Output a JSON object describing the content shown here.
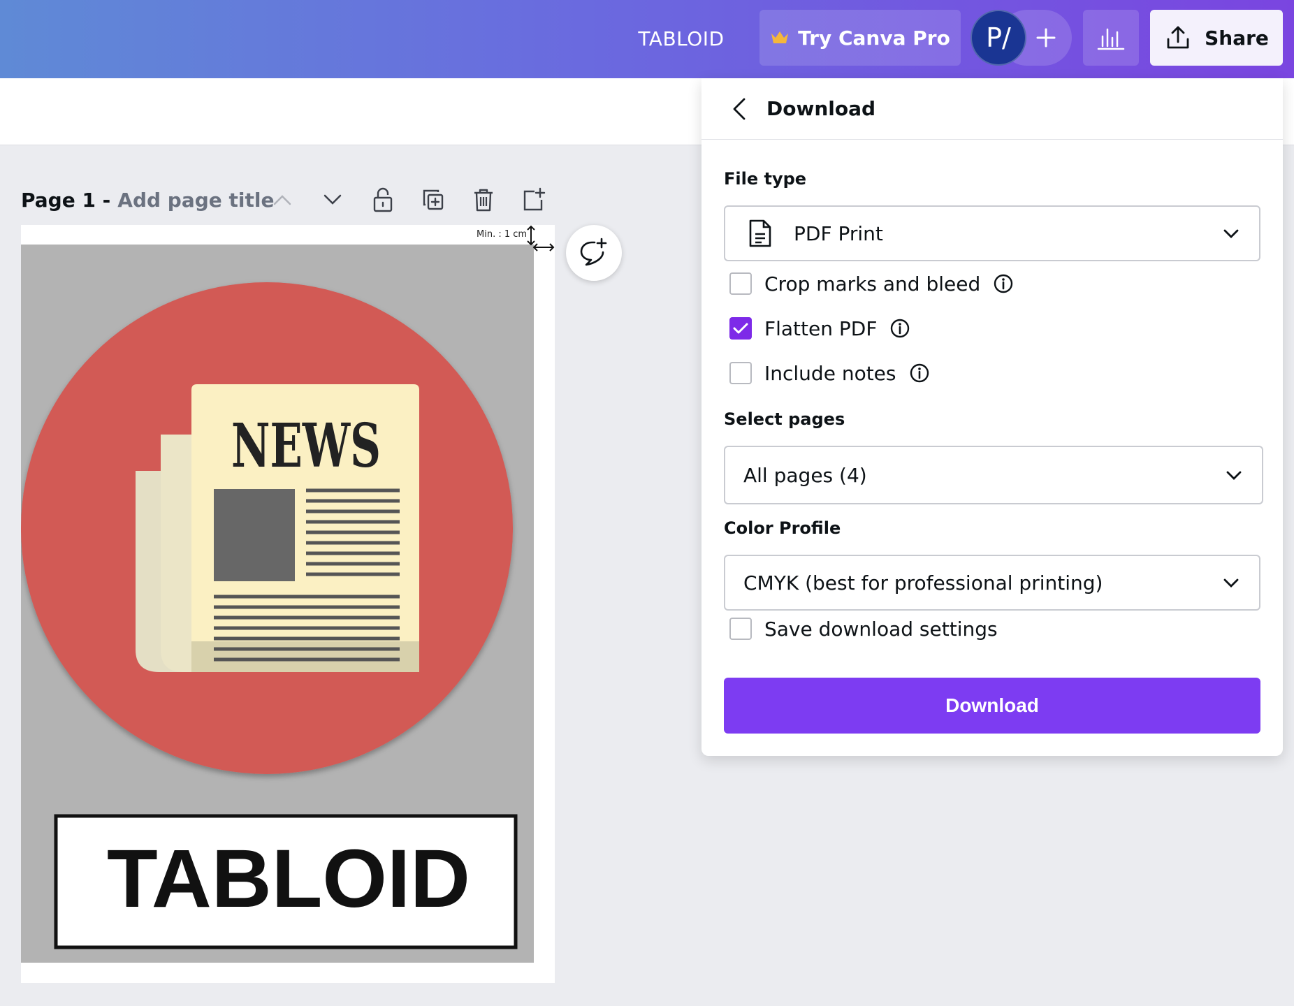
{
  "header": {
    "design_title": "TABLOID",
    "pro_button": "Try Canva Pro",
    "avatar_initials": "P/",
    "share_label": "Share"
  },
  "page": {
    "label": "Page 1 -",
    "title_placeholder": "Add page title",
    "bleed_note": "Min. : 1 cm"
  },
  "design": {
    "headline": "NEWS",
    "banner_text": "TABLOID"
  },
  "download_panel": {
    "title": "Download",
    "file_type_label": "File type",
    "file_type_value": "PDF Print",
    "options": [
      {
        "label": "Crop marks and bleed",
        "checked": false
      },
      {
        "label": "Flatten PDF",
        "checked": true
      },
      {
        "label": "Include notes",
        "checked": false
      }
    ],
    "select_pages_label": "Select pages",
    "select_pages_value": "All pages (4)",
    "color_profile_label": "Color Profile",
    "color_profile_value": "CMYK (best for professional printing)",
    "save_settings_label": "Save download settings",
    "save_settings_checked": false,
    "download_button": "Download"
  },
  "colors": {
    "accent": "#7d2ae8",
    "header_start": "#5f8ad6",
    "header_end": "#7a45e0",
    "avatar": "#1a3593",
    "design_circle": "#d25a55",
    "design_background": "#b3b3b3"
  }
}
